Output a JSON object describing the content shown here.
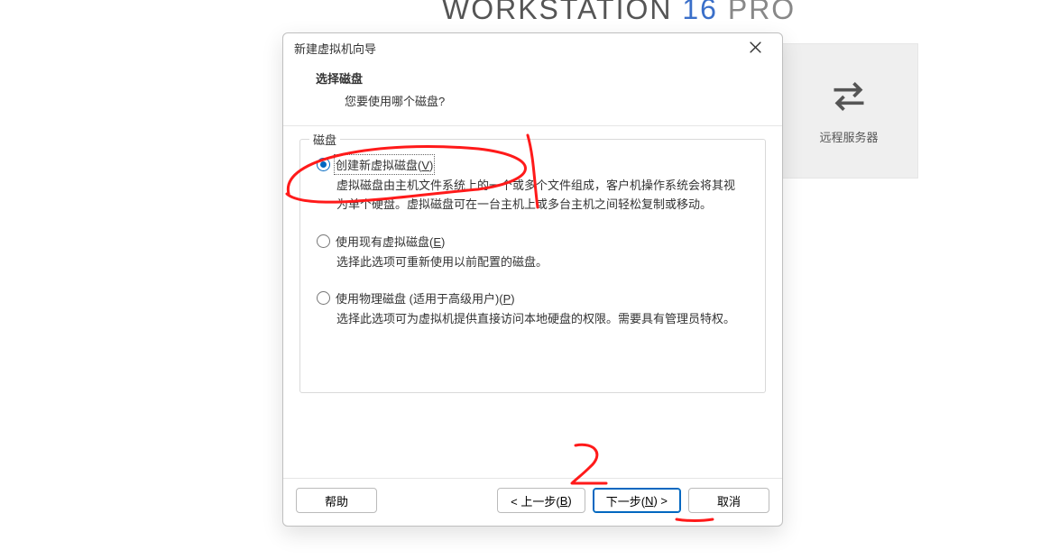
{
  "background": {
    "logo_workstation": "WORKSTATION",
    "logo_version": "16",
    "logo_edition": "PRO",
    "tile_label": "远程服务器"
  },
  "dialog": {
    "title": "新建虚拟机向导",
    "heading": "选择磁盘",
    "subheading": "您要使用哪个磁盘?",
    "group_label": "磁盘",
    "options": [
      {
        "label_pre": "创建新虚拟磁盘(",
        "mnemonic": "V",
        "label_post": ")",
        "desc": "虚拟磁盘由主机文件系统上的一个或多个文件组成，客户机操作系统会将其视为单个硬盘。虚拟磁盘可在一台主机上或多台主机之间轻松复制或移动。",
        "selected": true
      },
      {
        "label_pre": "使用现有虚拟磁盘(",
        "mnemonic": "E",
        "label_post": ")",
        "desc": "选择此选项可重新使用以前配置的磁盘。",
        "selected": false
      },
      {
        "label_pre": "使用物理磁盘 (适用于高级用户)(",
        "mnemonic": "P",
        "label_post": ")",
        "desc": "选择此选项可为虚拟机提供直接访问本地硬盘的权限。需要具有管理员特权。",
        "selected": false
      }
    ],
    "buttons": {
      "help": "帮助",
      "back_pre": "< 上一步(",
      "back_mn": "B",
      "back_post": ")",
      "next_pre": "下一步(",
      "next_mn": "N",
      "next_post": ") >",
      "cancel": "取消"
    }
  },
  "annotations": {
    "mark1": "1",
    "mark2": "2"
  }
}
